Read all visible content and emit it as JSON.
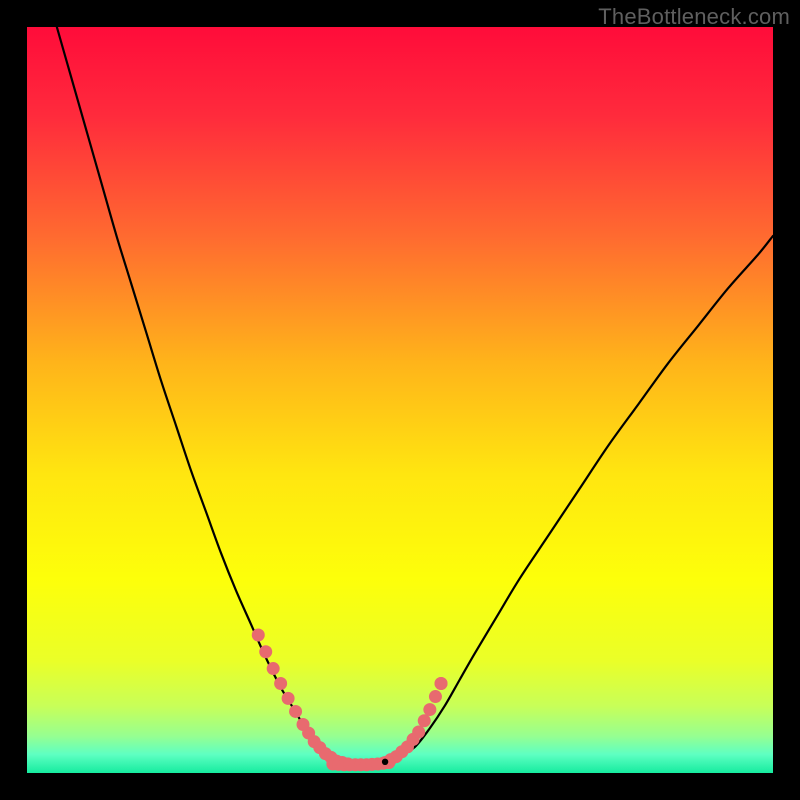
{
  "watermark": "TheBottleneck.com",
  "chart_data": {
    "type": "line",
    "title": "",
    "xlabel": "",
    "ylabel": "",
    "xlim": [
      0,
      100
    ],
    "ylim": [
      0,
      100
    ],
    "grid": false,
    "legend": false,
    "background": {
      "type": "vertical-gradient",
      "stops": [
        {
          "offset": 0.0,
          "color": "#ff0c3a"
        },
        {
          "offset": 0.12,
          "color": "#ff2b3c"
        },
        {
          "offset": 0.28,
          "color": "#ff6a30"
        },
        {
          "offset": 0.45,
          "color": "#ffb41a"
        },
        {
          "offset": 0.6,
          "color": "#ffe610"
        },
        {
          "offset": 0.74,
          "color": "#fdff0a"
        },
        {
          "offset": 0.85,
          "color": "#eaff28"
        },
        {
          "offset": 0.91,
          "color": "#c8ff58"
        },
        {
          "offset": 0.95,
          "color": "#97ff90"
        },
        {
          "offset": 0.975,
          "color": "#5effc2"
        },
        {
          "offset": 1.0,
          "color": "#16ec9f"
        }
      ]
    },
    "series": [
      {
        "name": "left-curve",
        "stroke": "#000000",
        "x": [
          4,
          6,
          8,
          10,
          12,
          14,
          16,
          18,
          20,
          22,
          24,
          26,
          28,
          30,
          32,
          34,
          35.5,
          37,
          38.5,
          40
        ],
        "y": [
          100,
          93,
          86,
          79,
          72,
          65.5,
          59,
          52.5,
          46.5,
          40.5,
          35,
          29.5,
          24.5,
          20,
          15.5,
          11.5,
          9,
          6.5,
          4,
          2.3
        ]
      },
      {
        "name": "right-curve",
        "stroke": "#000000",
        "x": [
          50,
          52,
          54,
          56,
          58,
          60,
          63,
          66,
          70,
          74,
          78,
          82,
          86,
          90,
          94,
          98,
          100
        ],
        "y": [
          2.3,
          3.5,
          6,
          9,
          12.5,
          16,
          21,
          26,
          32,
          38,
          44,
          49.5,
          55,
          60,
          65,
          69.5,
          72
        ]
      },
      {
        "name": "left-dotted-tail",
        "stroke": "#e86a6f",
        "style": "dotted",
        "x": [
          31,
          33,
          35,
          37,
          38.5,
          40,
          41.5,
          43
        ],
        "y": [
          18.5,
          14,
          10,
          6.5,
          4.2,
          2.6,
          1.6,
          1.2
        ]
      },
      {
        "name": "right-dotted-tail",
        "stroke": "#e86a6f",
        "style": "dotted",
        "x": [
          48,
          49.5,
          51,
          52.5,
          54,
          55.5
        ],
        "y": [
          1.4,
          2.2,
          3.5,
          5.5,
          8.5,
          12
        ]
      },
      {
        "name": "valley-floor",
        "stroke": "#e86a6f",
        "style": "dotted",
        "x": [
          41,
          42.5,
          44,
          45.5,
          47,
          48.5
        ],
        "y": [
          1.2,
          1.1,
          1.1,
          1.1,
          1.2,
          1.4
        ]
      }
    ],
    "marker": {
      "x": 48,
      "y": 1.5,
      "color": "#000000"
    }
  }
}
